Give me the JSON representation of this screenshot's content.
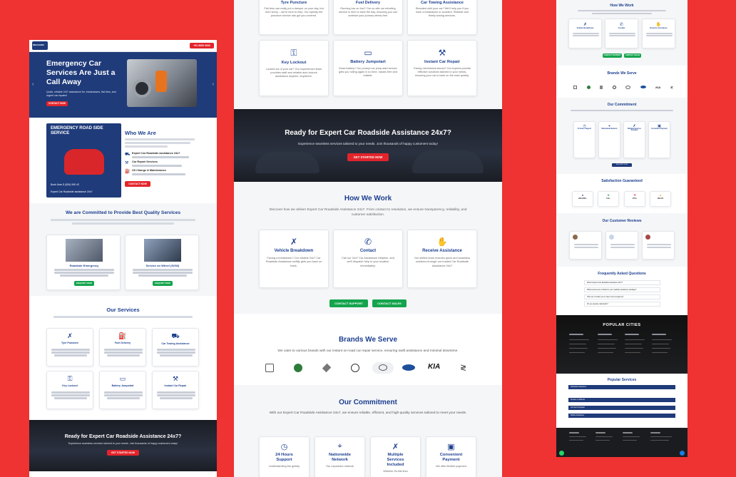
{
  "colors": {
    "background": "#ef3232",
    "brand_blue": "#1f3b7a",
    "accent_red": "#e3242b",
    "green": "#14a44d"
  },
  "left": {
    "header": {
      "logo_text": "MECHANIC",
      "phone": "+91 9000 0000"
    },
    "hero": {
      "title_line1": "Emergency Car",
      "title_line2": "Services Are Just a",
      "title_line3": "Call Away",
      "subtitle": "Quick, reliable 24/7 assistance for, breakdowns, flat tires, and urgent car repairs!",
      "cta": "CONTACT NOW"
    },
    "who": {
      "poster_title": "EMERGENCY ROAD SIDE SERVICE",
      "poster_phone": "Book Now   S (654) 900 42",
      "poster_footer": "Expert Car Roadside assistance 24x7",
      "title": "Who We Are",
      "items": [
        {
          "title": "Expert Car Roadside assistance 24x7"
        },
        {
          "title": "Car Repair Services"
        },
        {
          "title": "Oil Change & Maintenance"
        }
      ],
      "cta": "CONTACT NOW"
    },
    "committed": {
      "title": "We are Committed to Provide Best Quality Services",
      "cards": [
        {
          "title": "Roadside Emergency",
          "cta": "ENQUIRY NOW"
        },
        {
          "title": "Service on Wheel (SOW)",
          "cta": "ENQUIRY NOW"
        }
      ]
    },
    "services": {
      "title": "Our Services",
      "items": [
        {
          "label": "Tyre Puncture"
        },
        {
          "label": "Fuel Delivery"
        },
        {
          "label": "Car Towing Assistance"
        },
        {
          "label": "Key Lockout"
        },
        {
          "label": "Battery Jumpstart"
        },
        {
          "label": "Instant Car Repair"
        }
      ]
    },
    "banner": {
      "title": "Ready for Expert Car Roadside Assistance 24x7?",
      "subtitle": "Experience seamless services tailored to your needs. Join thousands of happy customers today!",
      "cta": "GET STARTED NOW"
    }
  },
  "center": {
    "top_cards": [
      {
        "title": "Tyre Puncture",
        "text": "Flat tires can really put a damper on your day, but don't worry – we're here to help. Our speedy tire puncture service has got you covered."
      },
      {
        "title": "Fuel Delivery",
        "text": "Running low on fuel? Our on-site car refueling service is here to save the day, ensuring you can continue your journey stress-free."
      },
      {
        "title": "Car Towing Assistance",
        "text": "Stranded with your car? We'll help you if you have a breakdown or accident. Reliable and timely towing services."
      }
    ],
    "services": [
      {
        "title": "Key Lockout",
        "text": "Locked out of your car? Our experienced team provides swift and reliable auto lockout assistance anytime, anywhere."
      },
      {
        "title": "Battery Jumpstart",
        "text": "Dead battery? Our prompt car jump-start service gets you rolling again in no time, hassle-free and reliable."
      },
      {
        "title": "Instant Car Repair",
        "text": "Facing mechanical issues? Our experts provide effective solutions tailored to your needs, ensuring your car is back on the road quickly."
      }
    ],
    "banner": {
      "title": "Ready for Expert Car Roadside Assistance 24x7?",
      "subtitle": "Experience seamless services tailored to your needs. Join thousands of happy customers today!",
      "cta": "GET STARTED NOW"
    },
    "how": {
      "title": "How We Work",
      "subtitle": "Discover how we deliver Expert Car Roadside Assistance 24x7. From contact to resolution, we ensure transparency, reliability, and customer satisfaction.",
      "steps": [
        {
          "title": "Vehicle Breakdown",
          "text": "Facing a breakdown? Our reliable 24x7 Car Roadside Assistance swiftly gets you back on track."
        },
        {
          "title": "Contact",
          "text": "Call our 24x7 Car Assistance Helpline, and we'll dispatch help to your location immediately."
        },
        {
          "title": "Receive Assistance",
          "text": "Our skilled team ensures quick and seamless solutions through our trusted Car Roadside Assistance 24x7"
        }
      ],
      "btn_support": "CONTACT SUPPORT",
      "btn_sales": "CONTACT SALES"
    },
    "brands": {
      "title": "Brands We Serve",
      "subtitle": "We cater to various brands with our instant on-road car repair service, ensuring swift assistance and minimal downtime.",
      "logos": [
        "VW-alt",
        "Skoda",
        "Renault",
        "Volkswagen",
        "Toyota",
        "Ford",
        "KIA",
        "Suzuki"
      ]
    },
    "commitment": {
      "title": "Our Commitment",
      "subtitle": "With our Expert Car Roadside Assistance 24x7, we ensure reliable, efficient, and high-quality services tailored to meet your needs.",
      "items": [
        {
          "title_line1": "24 Hours",
          "title_line2": "Support",
          "text": "Understanding the gravity"
        },
        {
          "title_line1": "Nationwide",
          "title_line2": "Network",
          "text": "Our expansive network"
        },
        {
          "title_line1": "Multiple",
          "title_line2": "Services",
          "title_line3": "Included",
          "text": "Whether it's flat tires"
        },
        {
          "title_line1": "Convenient",
          "title_line2": "Payment",
          "text": "We offer flexible payment"
        }
      ]
    }
  },
  "right": {
    "how": {
      "title": "How We Work",
      "steps": [
        "Vehicle Breakdown",
        "Contact",
        "Receive Assistance"
      ],
      "btn_support": "CONTACT SUPPORT",
      "btn_sales": "CONTACT SALES"
    },
    "brands_title": "Brands We Serve",
    "commitment": {
      "title": "Our Commitment",
      "items": [
        "24 Hours Support",
        "Nationwide Network",
        "Multiple Services Included",
        "Convenient Payment"
      ],
      "cta": "ENQUIRY NOW"
    },
    "satisfaction": {
      "title": "Satisfaction Guaranteed",
      "stats": [
        "200,000+",
        "5.0+",
        "275+",
        "99.4%"
      ]
    },
    "reviews_title": "Our Customer Reviews",
    "faq": {
      "title": "Frequently Asked Questions",
      "questions": [
        "What is Expert Car Roadside Assistance 24x7?",
        "What services are included in your roadside assistance package?",
        "How can I contact you in case of an emergency?",
        "Do you operate nationwide?"
      ]
    },
    "cities_title": "POPULAR CITIES",
    "popular": {
      "title": "Popular Services",
      "items": [
        "Roadside Assistance",
        "Service on Wheels",
        "Car Self Jumpstart",
        "Mobile Assistance"
      ]
    }
  }
}
